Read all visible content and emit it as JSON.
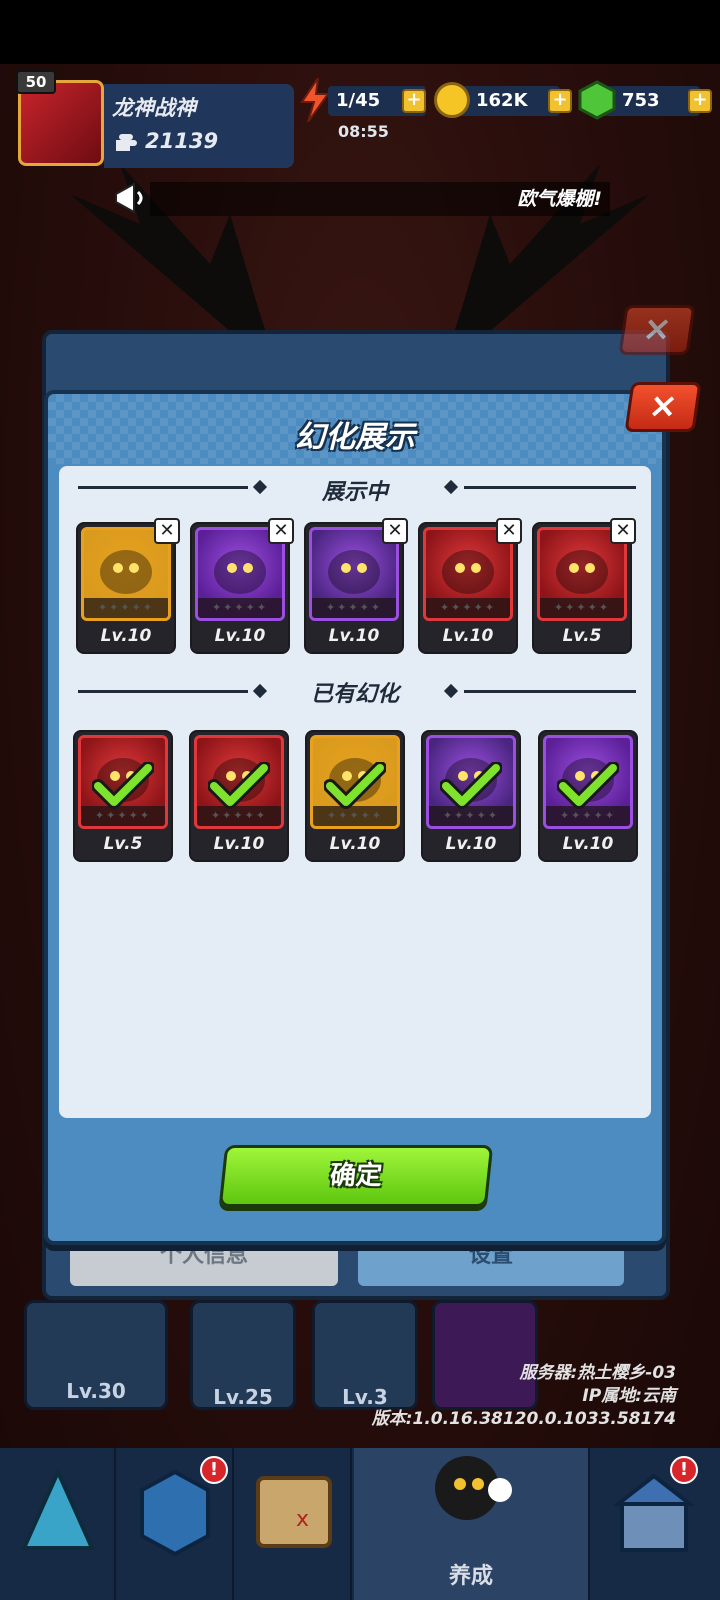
{
  "player": {
    "level": "50",
    "name": "龙神战神",
    "power": "21139"
  },
  "resources": {
    "energy": "1/45",
    "energy_timer": "08:55",
    "coins": "162K",
    "gems": "753"
  },
  "announcement": "欧气爆棚!",
  "modal": {
    "title": "幻化展示",
    "section_showing": "展示中",
    "section_owned": "已有幻化",
    "confirm_label": "确定",
    "showing": [
      {
        "name": "golden-spiky-skin",
        "level": "Lv.10",
        "frame": "#e7a11f",
        "bg": "#d99a1d"
      },
      {
        "name": "green-serpent-skin",
        "level": "Lv.10",
        "frame": "#9b4fe0",
        "bg": "#5b1f97"
      },
      {
        "name": "purple-fang-beast-skin",
        "level": "Lv.10",
        "frame": "#9b4fe0",
        "bg": "#4a2580"
      },
      {
        "name": "red-horned-demon-skin",
        "level": "Lv.10",
        "frame": "#e0383a",
        "bg": "#8d1418"
      },
      {
        "name": "blue-shadow-dragon-skin",
        "level": "Lv.5",
        "frame": "#e0383a",
        "bg": "#8d1418"
      }
    ],
    "owned": [
      {
        "name": "blue-shadow-dragon-skin",
        "level": "Lv.5",
        "frame": "#e0383a",
        "bg": "#8d1418"
      },
      {
        "name": "red-horned-demon-skin",
        "level": "Lv.10",
        "frame": "#e0383a",
        "bg": "#8d1418"
      },
      {
        "name": "golden-spiky-skin",
        "level": "Lv.10",
        "frame": "#e7a11f",
        "bg": "#d99a1d"
      },
      {
        "name": "purple-fang-beast-skin",
        "level": "Lv.10",
        "frame": "#9b4fe0",
        "bg": "#4a2580"
      },
      {
        "name": "green-serpent-skin",
        "level": "Lv.10",
        "frame": "#9b4fe0",
        "bg": "#5b1f97"
      }
    ]
  },
  "background": {
    "equipment_levels": [
      "Lv.30",
      "Lv.25",
      "Lv.3"
    ],
    "server_line1": "服务器:热土樱乡-03",
    "server_line2": "IP属地:云南",
    "server_line3": "版本:1.0.16.38120.0.1033.58174",
    "nav_active_label": "养成",
    "behind_panel_left": "个人信息",
    "behind_panel_right": "设置"
  },
  "colors": {
    "modal_blue": "#4d8cc0",
    "confirm_green": "#7cde22",
    "close_red": "#e23e21",
    "check_green": "#7fe22c"
  }
}
